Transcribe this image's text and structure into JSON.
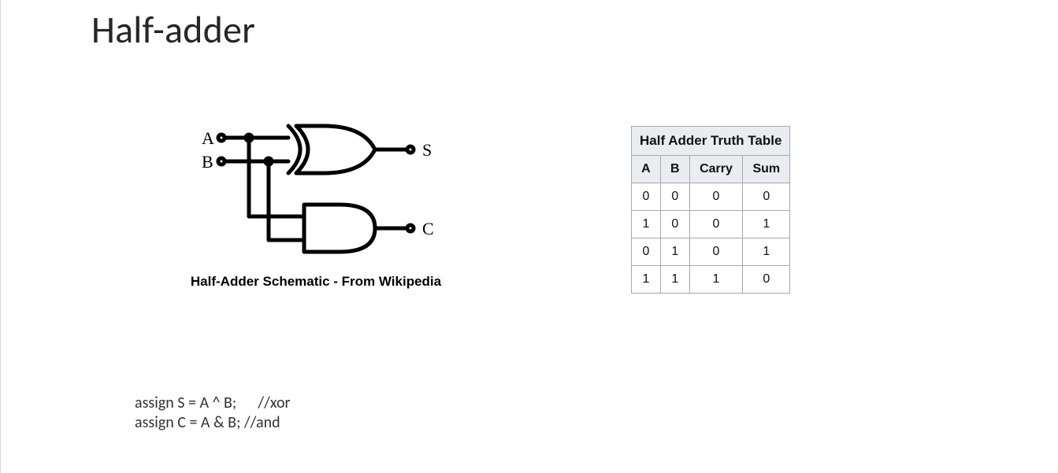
{
  "title": "Half-adder",
  "schematic": {
    "input_a": "A",
    "input_b": "B",
    "output_s": "S",
    "output_c": "C",
    "caption": "Half-Adder Schematic - From Wikipedia"
  },
  "truth_table": {
    "title": "Half Adder Truth Table",
    "headers": {
      "a": "A",
      "b": "B",
      "carry": "Carry",
      "sum": "Sum"
    },
    "rows": [
      {
        "a": "0",
        "b": "0",
        "carry": "0",
        "sum": "0"
      },
      {
        "a": "1",
        "b": "0",
        "carry": "0",
        "sum": "1"
      },
      {
        "a": "0",
        "b": "1",
        "carry": "0",
        "sum": "1"
      },
      {
        "a": "1",
        "b": "1",
        "carry": "1",
        "sum": "0"
      }
    ]
  },
  "code": {
    "line1": "assign S = A ^ B;      //xor",
    "line2": "assign C = A & B; //and"
  },
  "chart_data": {
    "type": "table",
    "title": "Half Adder Truth Table",
    "columns": [
      "A",
      "B",
      "Carry",
      "Sum"
    ],
    "rows": [
      [
        0,
        0,
        0,
        0
      ],
      [
        1,
        0,
        0,
        1
      ],
      [
        0,
        1,
        0,
        1
      ],
      [
        1,
        1,
        1,
        0
      ]
    ]
  }
}
